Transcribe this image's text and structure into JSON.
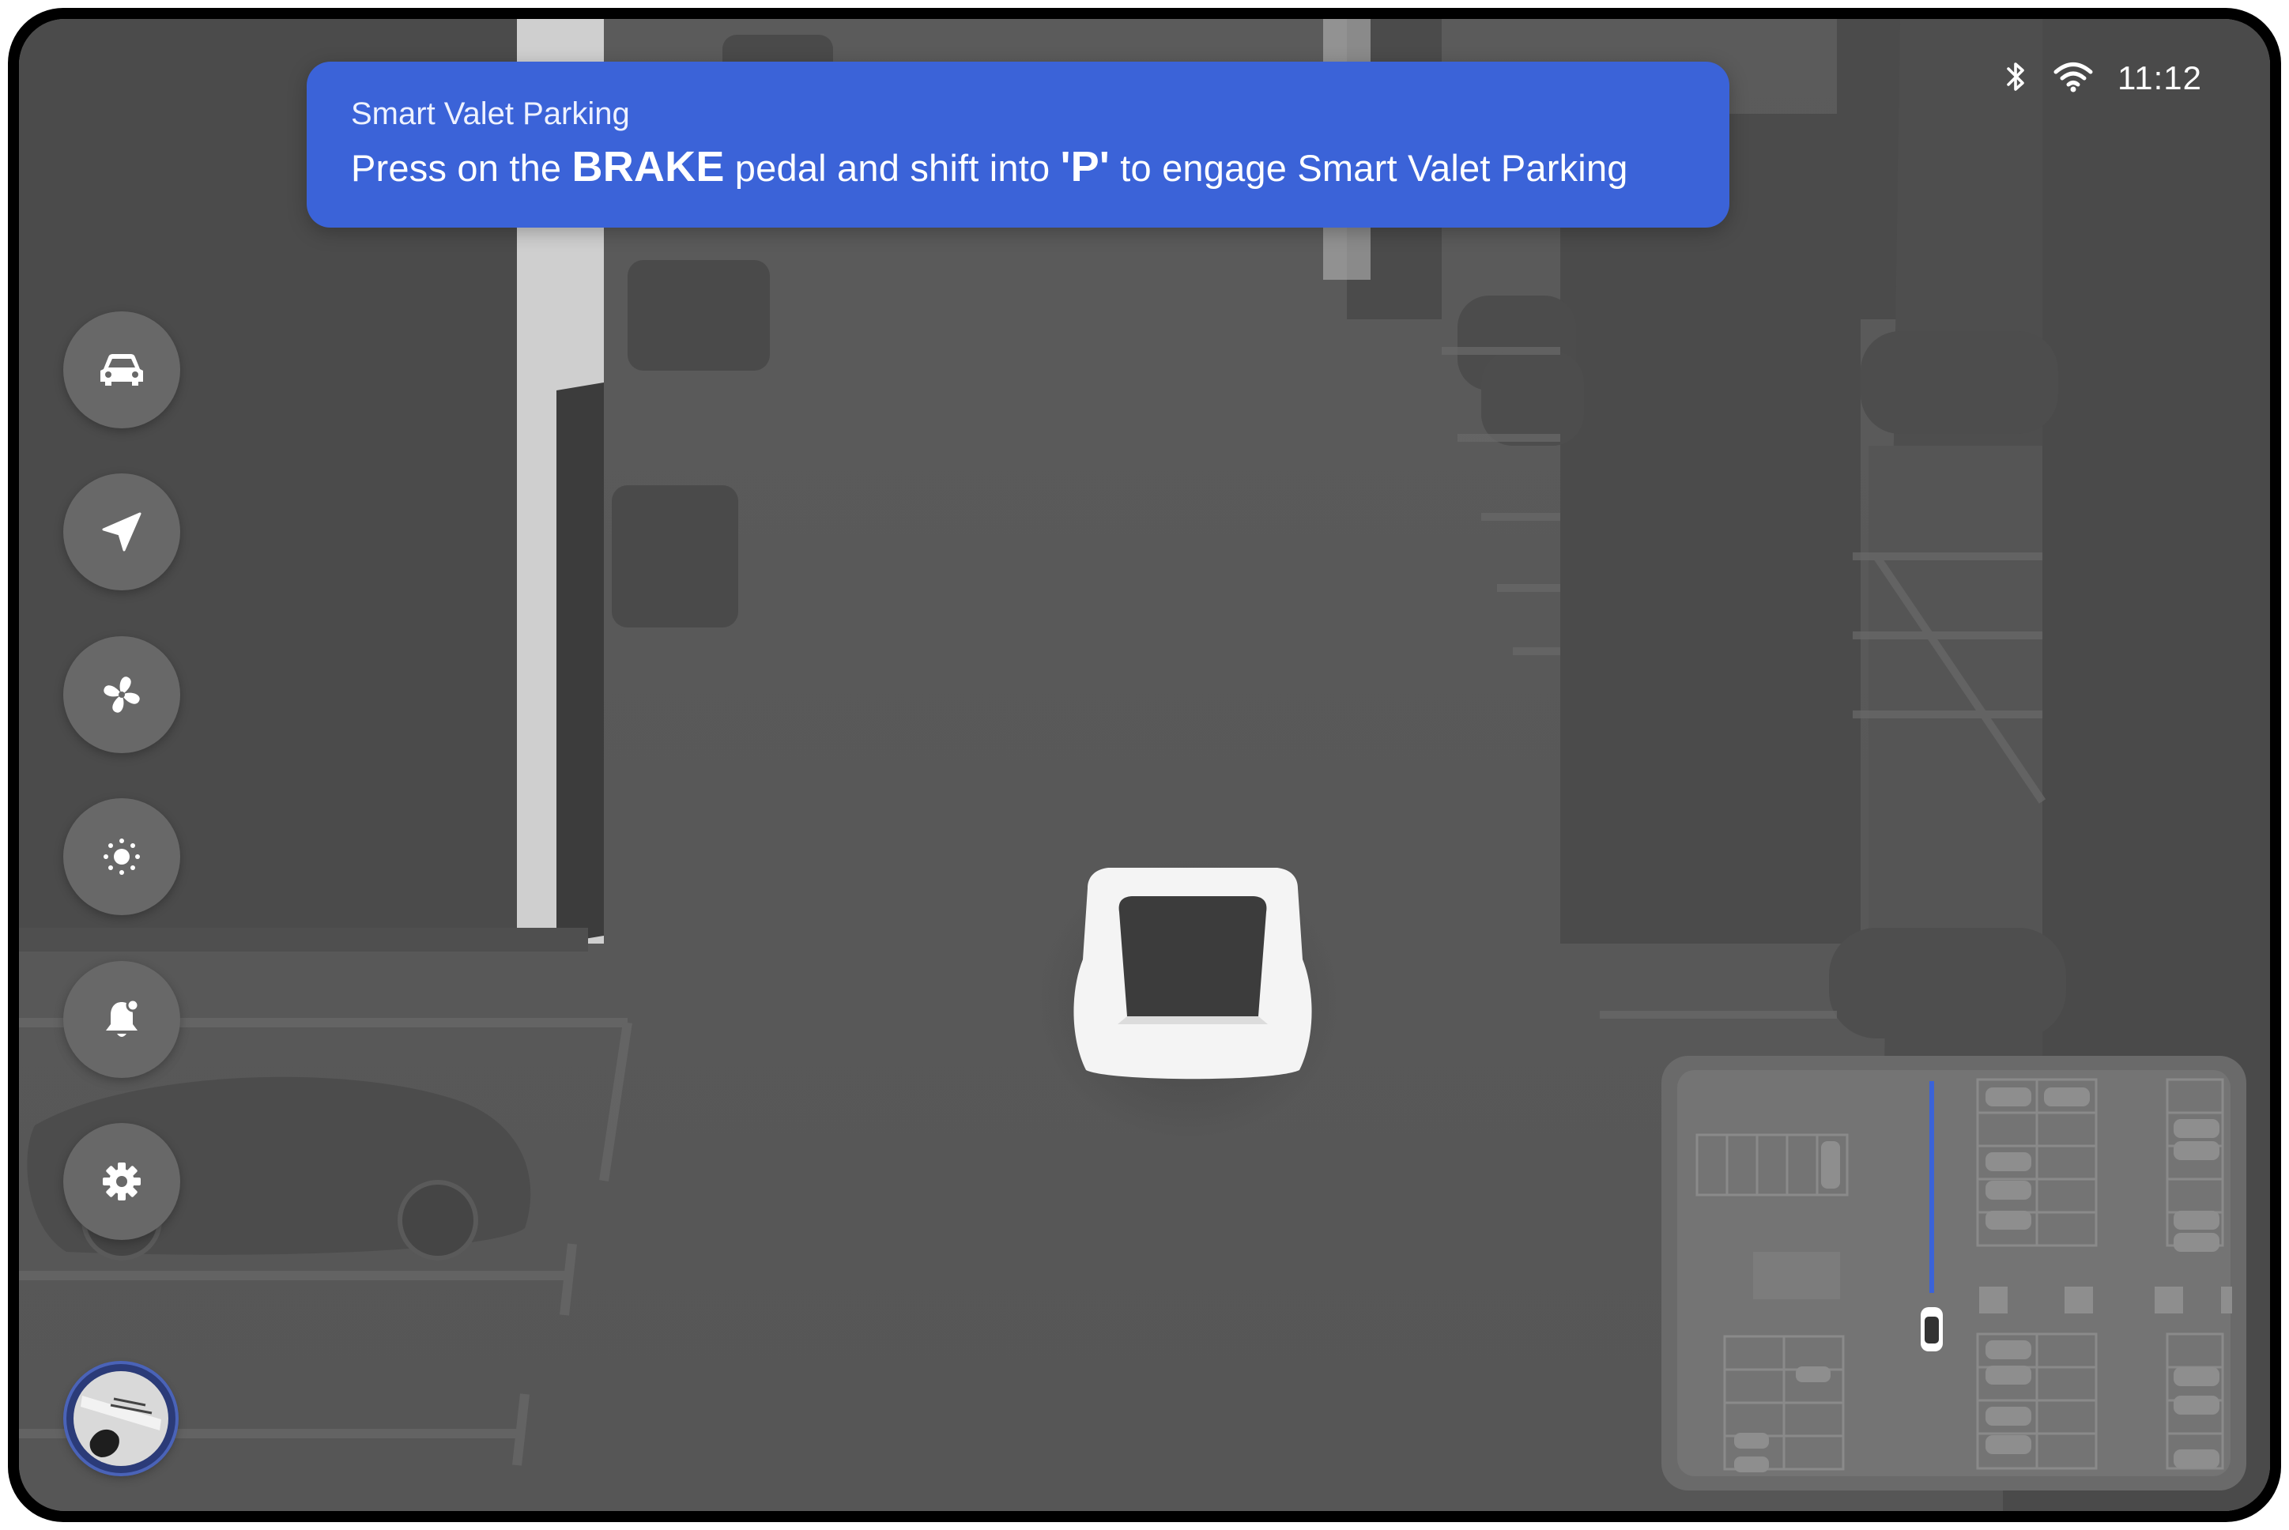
{
  "banner": {
    "title": "Smart Valet Parking",
    "message_parts": [
      "Press on the ",
      "BRAKE",
      " pedal and shift into ",
      "'P'",
      " to engage Smart Valet Parking"
    ]
  },
  "status_bar": {
    "time": "11:12",
    "icons": [
      "bluetooth-icon",
      "wifi-icon"
    ]
  },
  "sidebar": {
    "items": [
      {
        "name": "car",
        "icon": "car-icon"
      },
      {
        "name": "navigation",
        "icon": "navigation-arrow-icon"
      },
      {
        "name": "climate",
        "icon": "fan-icon"
      },
      {
        "name": "display",
        "icon": "brightness-icon"
      },
      {
        "name": "notifications",
        "icon": "bell-icon"
      },
      {
        "name": "settings",
        "icon": "gear-icon"
      }
    ],
    "profile": {
      "icon": "profile-avatar"
    }
  },
  "colors": {
    "banner": "#3b63d8",
    "scene_floor": "#5a5a5a",
    "button": "#686868",
    "route_line": "#3b63d8"
  }
}
